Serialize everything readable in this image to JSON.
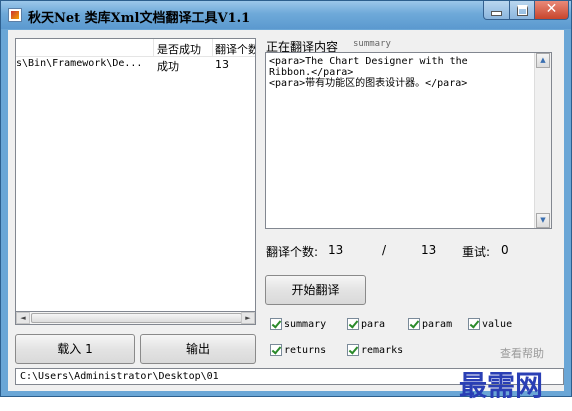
{
  "window": {
    "title": "秋天Net  类库Xml文档翻译工具V1.1"
  },
  "controls": {
    "close": "✕"
  },
  "listview": {
    "columns": [
      "",
      "是否成功",
      "翻译个数"
    ],
    "rows": [
      {
        "path": "s\\Bin\\Framework\\De...",
        "success": "成功",
        "count": "13"
      }
    ]
  },
  "scroll": {
    "left": "◄",
    "right": "►",
    "up": "▲",
    "down": "▼"
  },
  "buttons": {
    "load": "载入 1",
    "output": "输出",
    "start": "开始翻译"
  },
  "translating": {
    "label": "正在翻译内容",
    "tag": "summary",
    "content": "<para>The Chart Designer with the\nRibbon.</para>\n<para>带有功能区的图表设计器。</para>"
  },
  "stats": {
    "count_label": "翻译个数:",
    "done": "13",
    "sep": "/",
    "total": "13",
    "retry_label": "重试:",
    "retry": "0"
  },
  "checkboxes": [
    {
      "label": "summary",
      "checked": true
    },
    {
      "label": "para",
      "checked": true
    },
    {
      "label": "param",
      "checked": true
    },
    {
      "label": "value",
      "checked": true
    },
    {
      "label": "returns",
      "checked": true
    },
    {
      "label": "remarks",
      "checked": true
    }
  ],
  "help_link": "查看帮助",
  "status_path": "C:\\Users\\Administrator\\Desktop\\01",
  "watermark": "最需网",
  "colors": {
    "title_bar": "#6ea9d9",
    "close_button": "#c8452c",
    "check": "#2a8a2a",
    "watermark": "#2a3fb5"
  }
}
